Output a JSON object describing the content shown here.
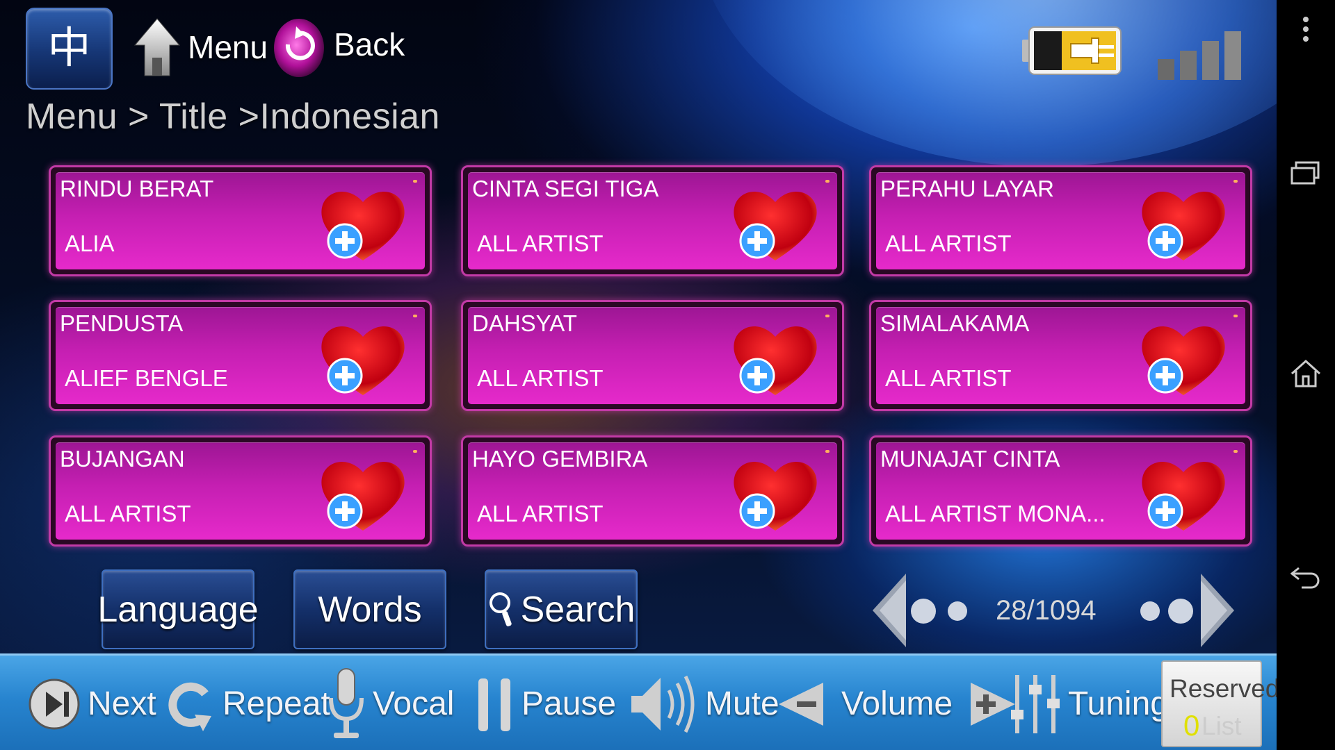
{
  "top_bar": {
    "chinese_button_label": "中",
    "menu_label": "Menu",
    "back_label": "Back"
  },
  "breadcrumb": "Menu > Title >Indonesian",
  "songs": [
    {
      "title": "RINDU BERAT",
      "artist": "ALIA"
    },
    {
      "title": "CINTA SEGI TIGA",
      "artist": "ALL ARTIST"
    },
    {
      "title": "PERAHU LAYAR",
      "artist": "ALL ARTIST"
    },
    {
      "title": "PENDUSTA",
      "artist": "ALIEF BENGLE"
    },
    {
      "title": "DAHSYAT",
      "artist": "ALL ARTIST"
    },
    {
      "title": "SIMALAKAMA",
      "artist": "ALL ARTIST"
    },
    {
      "title": "BUJANGAN",
      "artist": "ALL ARTIST"
    },
    {
      "title": "HAYO GEMBIRA",
      "artist": "ALL ARTIST"
    },
    {
      "title": "MUNAJAT CINTA",
      "artist": "ALL ARTIST MONA..."
    }
  ],
  "filter_buttons": {
    "language": "Language",
    "words": "Words",
    "search": "Search"
  },
  "pager": {
    "counter": "28/1094"
  },
  "controls": {
    "next": "Next",
    "repeat": "Repeat",
    "vocal": "Vocal",
    "pause": "Pause",
    "mute": "Mute",
    "volume": "Volume",
    "tuning": "Tuning"
  },
  "reserved": {
    "label": "Reserved",
    "count": "0",
    "list_label": "List"
  },
  "colors": {
    "card_pink": "#e62acb",
    "bottom_bar_blue": "#2784cf",
    "battery_yellow": "#f0c020"
  },
  "icons": [
    "home-icon",
    "back-icon",
    "battery-charging-icon",
    "signal-icon",
    "heart-add-icon",
    "search-icon",
    "next-icon",
    "repeat-icon",
    "microphone-icon",
    "pause-icon",
    "speaker-icon",
    "volume-down-icon",
    "volume-up-icon",
    "equalizer-icon"
  ]
}
